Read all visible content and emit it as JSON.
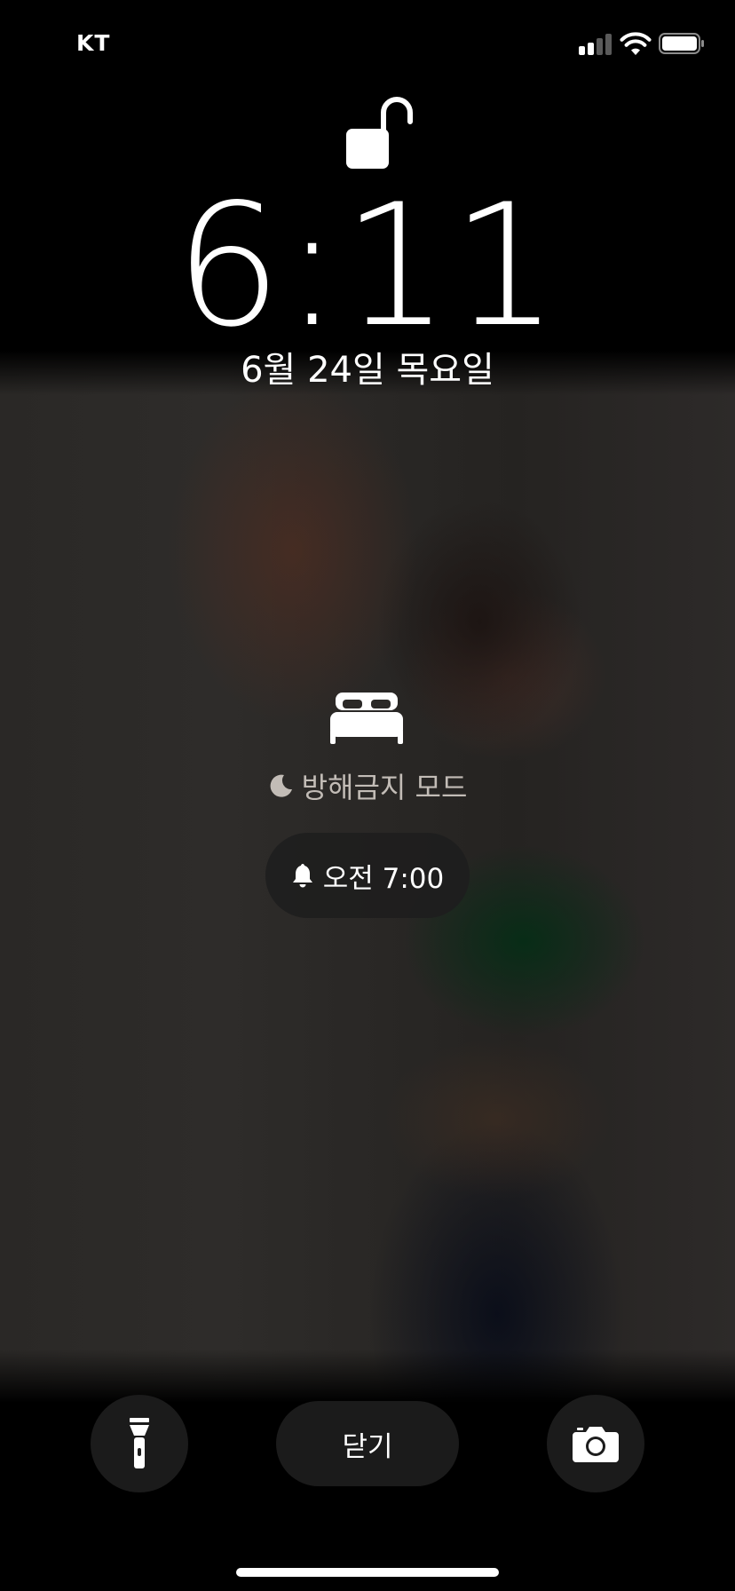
{
  "status_bar": {
    "carrier": "KT",
    "signal_bars_active": 2,
    "signal_bars_total": 4,
    "battery_level": 1.0
  },
  "lock_screen": {
    "lock_state": "unlocked",
    "time": "6:11",
    "date": "6월 24일 목요일"
  },
  "sleep_focus": {
    "icon": "bed-icon",
    "focus_icon": "moon-icon",
    "focus_label": "방해금지 모드",
    "alarm_icon": "bell-icon",
    "alarm_label": "오전 7:00"
  },
  "bottom_controls": {
    "flashlight_icon": "flashlight-icon",
    "close_label": "닫기",
    "camera_icon": "camera-icon"
  },
  "colors": {
    "text": "#ffffff",
    "focus_text": "#c2bcb6",
    "pill_background": "#1e1e1e"
  }
}
